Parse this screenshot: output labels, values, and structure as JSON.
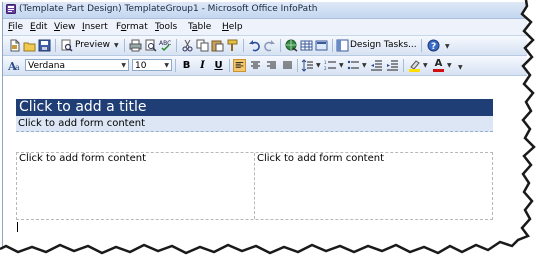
{
  "window": {
    "title": "(Template Part Design) TemplateGroup1 - Microsoft Office InfoPath"
  },
  "menu": {
    "items": [
      "File",
      "Edit",
      "View",
      "Insert",
      "Format",
      "Tools",
      "Table",
      "Help"
    ],
    "accelerators": [
      "F",
      "E",
      "V",
      "I",
      "o",
      "T",
      "a",
      "H"
    ]
  },
  "toolbar_standard": {
    "preview_label": "Preview",
    "design_tasks_label": "Design Tasks..."
  },
  "toolbar_format": {
    "font_name": "Verdana",
    "font_size": "10",
    "bold": "B",
    "italic": "I",
    "underline": "U",
    "font_color_glyph": "A"
  },
  "form": {
    "title_placeholder": "Click to add a title",
    "content_placeholder": "Click to add form content",
    "cell_left_placeholder": "Click to add form content",
    "cell_right_placeholder": "Click to add form content"
  },
  "colors": {
    "title_band": "#1f3e75",
    "content_band": "#dce6f4",
    "toolbar_top": "#f6f9fe",
    "toolbar_bottom": "#d6e2f3",
    "highlight": "#f5c66b"
  },
  "icons": [
    "app-icon",
    "new-icon",
    "open-icon",
    "save-icon",
    "preview-icon",
    "print-icon",
    "print-preview-icon",
    "spelling-icon",
    "cut-icon",
    "copy-icon",
    "paste-icon",
    "format-painter-icon",
    "undo-icon",
    "redo-icon",
    "hyperlink-icon",
    "table-icon",
    "layout-table-icon",
    "design-tasks-icon",
    "help-icon",
    "font-style-icon",
    "align-left-icon",
    "align-center-icon",
    "align-right-icon",
    "justify-icon",
    "line-spacing-icon",
    "numbering-icon",
    "bullets-icon",
    "decrease-indent-icon",
    "increase-indent-icon",
    "highlight-icon",
    "font-color-icon"
  ]
}
